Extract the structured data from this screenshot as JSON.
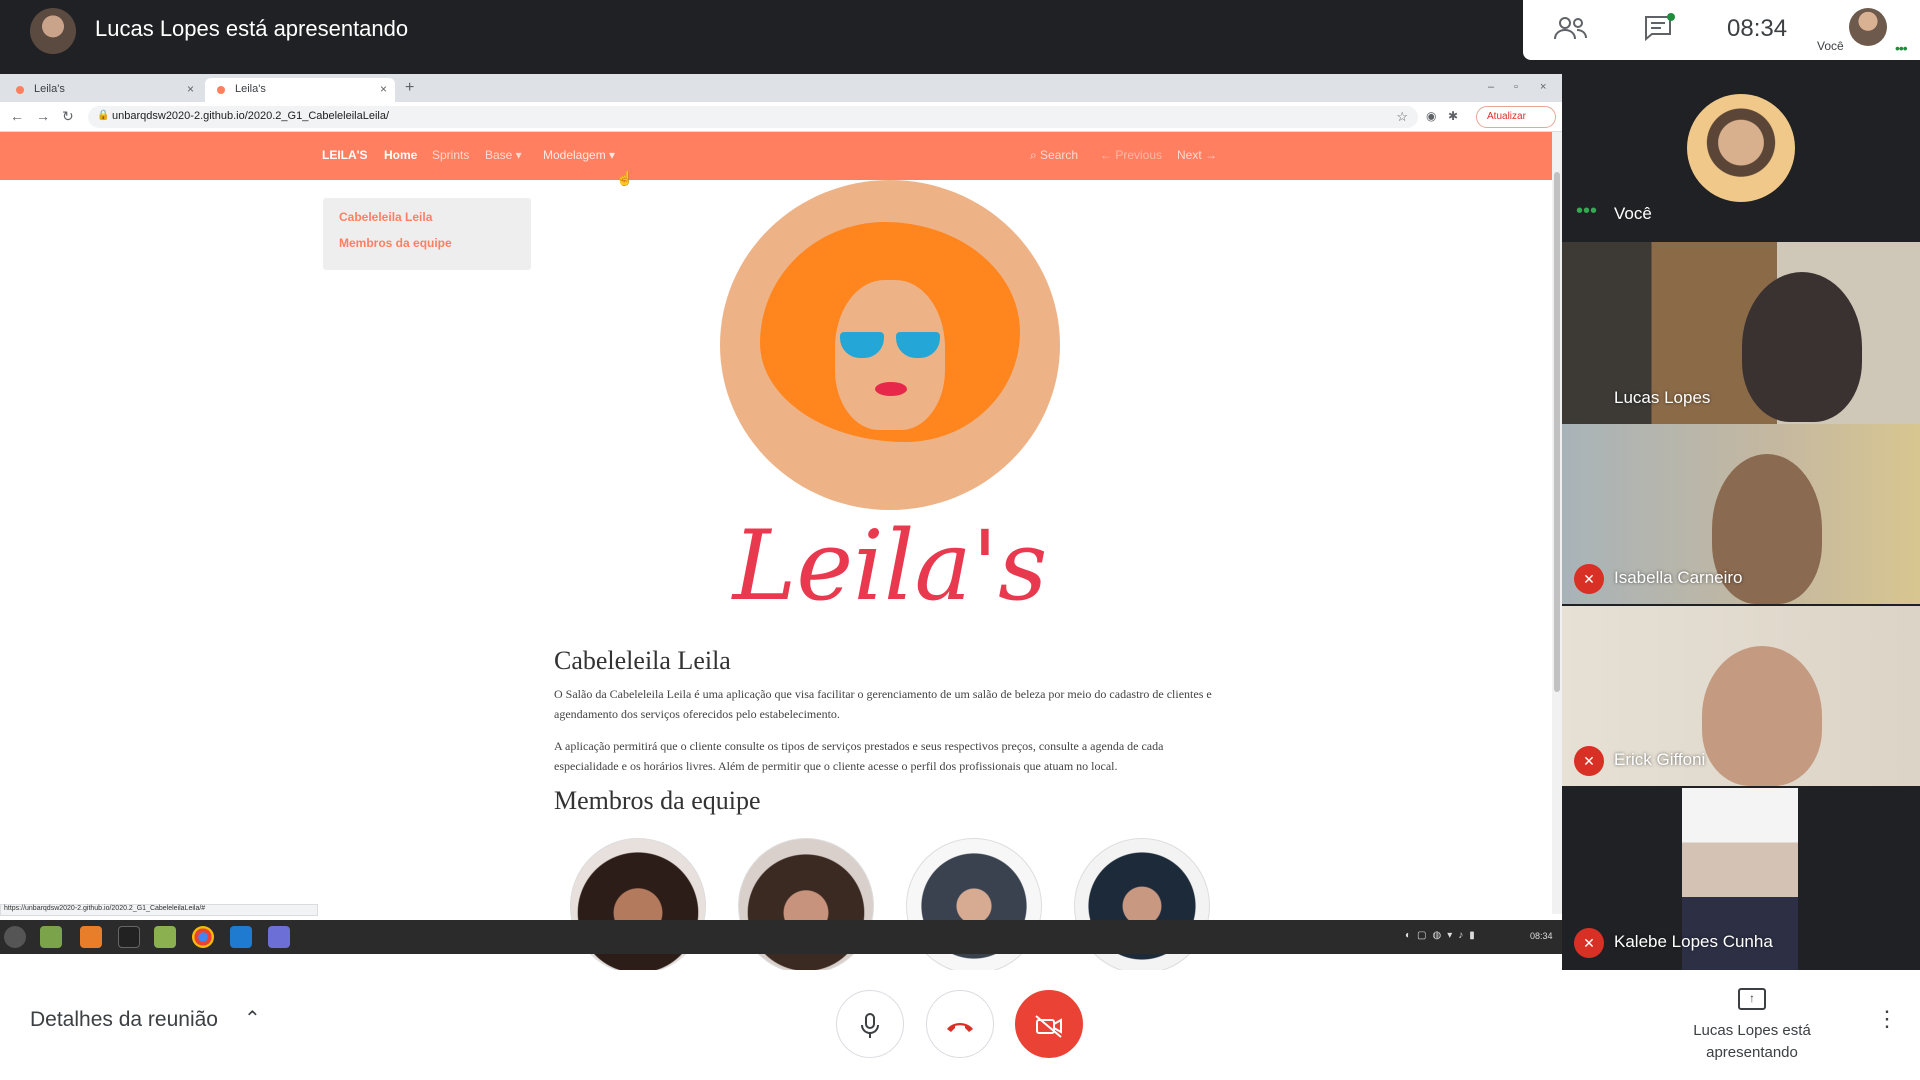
{
  "meeting": {
    "presenter_banner": "Lucas Lopes está apresentando",
    "clock": "08:34",
    "self_mini_label": "Você",
    "self_dots": "•••"
  },
  "browser": {
    "tabs": [
      {
        "title": "Leila's",
        "close": "×"
      },
      {
        "title": "Leila's",
        "close": "×"
      }
    ],
    "new_tab": "+",
    "window_controls": [
      "–",
      "▫",
      "×"
    ],
    "url": "unbarqdsw2020-2.github.io/2020.2_G1_CabeleleilaLeila/",
    "update_button": "Atualizar",
    "status_url": "https://unbarqdsw2020-2.github.io/2020.2_G1_CabeleleilaLeila/#"
  },
  "site": {
    "brand": "LEILA'S",
    "nav": {
      "home": "Home",
      "sprints": "Sprints",
      "base": "Base ▾",
      "modelagem": "Modelagem ▾",
      "search": "⌕ Search",
      "previous": "← Previous",
      "next": "Next →"
    },
    "toc": [
      "Cabeleleila Leila",
      "Membros da equipe"
    ],
    "logo_text": "Leila's",
    "heading": "Cabeleleila Leila",
    "paragraphs": [
      "O Salão da Cabeleleila Leila é uma aplicação que visa facilitar o gerenciamento de um salão de beleza por meio do cadastro de clientes e agendamento dos serviços oferecidos pelo estabelecimento.",
      "A aplicação permitirá que o cliente consulte os tipos de serviços prestados e seus respectivos preços, consulte a agenda de cada especialidade e os horários livres. Além de permitir que o cliente acesse o perfil dos profissionais que atuam no local."
    ],
    "team_heading": "Membros da equipe"
  },
  "taskbar": {
    "time": "08:34"
  },
  "participants": {
    "self": "Você",
    "tiles": [
      {
        "name": "Lucas Lopes"
      },
      {
        "name": "Isabella Carneiro"
      },
      {
        "name": "Erick Giffoni"
      },
      {
        "name": "Kalebe Lopes Cunha"
      }
    ]
  },
  "bottom": {
    "details": "Detalhes da reunião",
    "present_label": "Lucas Lopes está apresentando"
  },
  "colors": {
    "site_accent": "#ff7f60",
    "hangup_red": "#ea4335",
    "logo_red": "#e8394f"
  },
  "icons": [
    "people-icon",
    "chat-icon",
    "mic-icon",
    "hangup-icon",
    "camera-off-icon",
    "present-icon",
    "more-vert-icon",
    "mic-off-icon",
    "chevron-up-icon"
  ]
}
